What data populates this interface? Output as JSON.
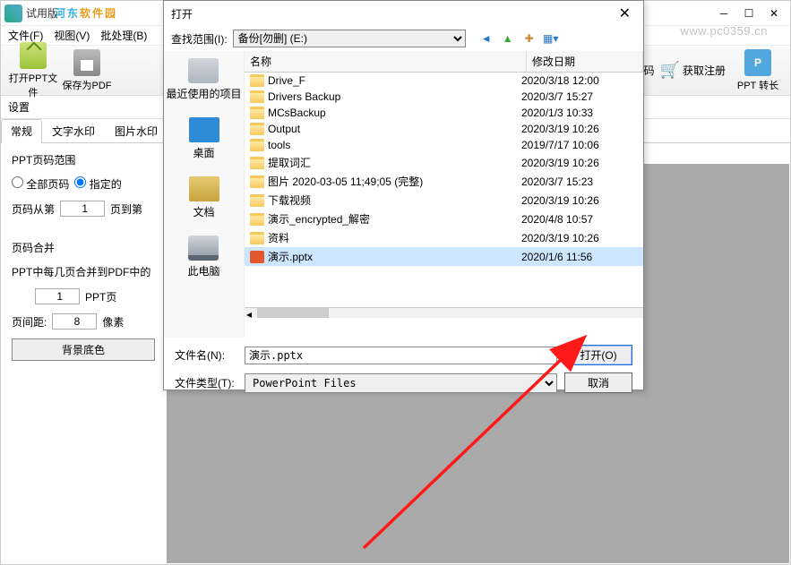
{
  "window": {
    "title": "  试用版"
  },
  "menu": {
    "file": "文件(F)",
    "view": "视图(V)",
    "batch": "批处理(B)"
  },
  "watermark_url": "www.pc0359.cn",
  "brand_river": "河东软件园",
  "toolbar": {
    "open": "打开PPT文件",
    "save": "保存为PDF",
    "convert": "PPT 转长",
    "reg_code": "输入注册码",
    "get_reg": "获取注册"
  },
  "settings": {
    "label": "设置",
    "tabs": {
      "general": "常规",
      "text_wm": "文字水印",
      "img_wm": "图片水印"
    },
    "range_label": "PPT页码范围",
    "all_pages": "全部页码",
    "specified": "指定的",
    "page_from": "页码从第",
    "page_from_val": "1",
    "page_to": "页到第",
    "merge_label": "页码合并",
    "merge_desc": "PPT中每几页合并到PDF中的",
    "ppt_count_val": "1",
    "ppt_unit": "PPT页",
    "gap_label": "页间距:",
    "gap_val": "8",
    "pixel": "像素",
    "bgcolor_btn": "背景底色"
  },
  "dialog": {
    "title": "打开",
    "lookup_label": "查找范围(I):",
    "drive": "备份[勿删] (E:)",
    "places": {
      "recent": "最近使用的项目",
      "desktop": "桌面",
      "docs": "文档",
      "pc": "此电脑"
    },
    "cols": {
      "name": "名称",
      "date": "修改日期"
    },
    "files": [
      {
        "n": "Drive_F",
        "d": "2020/3/18 12:00",
        "t": "folder"
      },
      {
        "n": "Drivers Backup",
        "d": "2020/3/7 15:27",
        "t": "folder"
      },
      {
        "n": "MCsBackup",
        "d": "2020/1/3 10:33",
        "t": "folder"
      },
      {
        "n": "Output",
        "d": "2020/3/19 10:26",
        "t": "folder"
      },
      {
        "n": "tools",
        "d": "2019/7/17 10:06",
        "t": "folder"
      },
      {
        "n": "提取词汇",
        "d": "2020/3/19 10:26",
        "t": "folder"
      },
      {
        "n": "图片 2020-03-05 11;49;05 (完整)",
        "d": "2020/3/7 15:23",
        "t": "folder"
      },
      {
        "n": "下载视频",
        "d": "2020/3/19 10:26",
        "t": "folder"
      },
      {
        "n": "演示_encrypted_解密",
        "d": "2020/4/8 10:57",
        "t": "folder"
      },
      {
        "n": "资料",
        "d": "2020/3/19 10:26",
        "t": "folder"
      },
      {
        "n": "演示.pptx",
        "d": "2020/1/6 11:56",
        "t": "pptx",
        "sel": true
      }
    ],
    "filename_label": "文件名(N):",
    "filename_val": "演示.pptx",
    "filetype_label": "文件类型(T):",
    "filetype_val": "PowerPoint Files",
    "open_btn": "打开(O)",
    "cancel_btn": "取消"
  }
}
